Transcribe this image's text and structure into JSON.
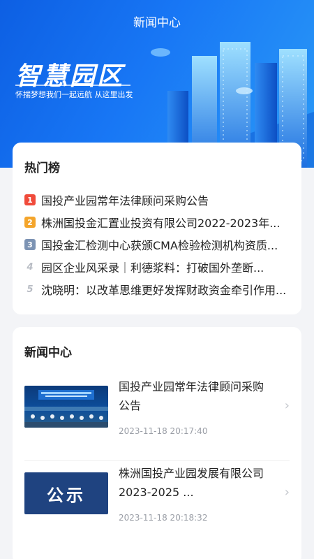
{
  "header": {
    "title": "新闻中心"
  },
  "banner": {
    "brand": "智慧园区",
    "slogan": "怀揣梦想我们一起远航 从这里出发"
  },
  "hot": {
    "title": "热门榜",
    "items": [
      {
        "rank": "1",
        "text": "国投产业园常年法律顾问采购公告",
        "color": "#f04b3b"
      },
      {
        "rank": "2",
        "text": "株洲国投金汇置业投资有限公司2022-2023年...",
        "color": "#f4a52b"
      },
      {
        "rank": "3",
        "text": "国投金汇检测中心获颁CMA检验检测机构资质...",
        "color": "#7c93b3"
      },
      {
        "rank": "4",
        "text": "园区企业风采录｜利德浆料：打破国外垄断...",
        "color": ""
      },
      {
        "rank": "5",
        "text": "沈晓明：以改革思维更好发挥财政资金牵引作用...",
        "color": ""
      }
    ]
  },
  "news": {
    "title": "新闻中心",
    "items": [
      {
        "title": "国投产业园常年法律顾问采购公告",
        "date": "2023-11-18 20:17:40",
        "thumb": "meeting-photo"
      },
      {
        "title": "株洲国投产业园发展有限公司2023-2025 ...",
        "date": "2023-11-18 20:18:32",
        "thumb_text": "公示"
      }
    ]
  }
}
